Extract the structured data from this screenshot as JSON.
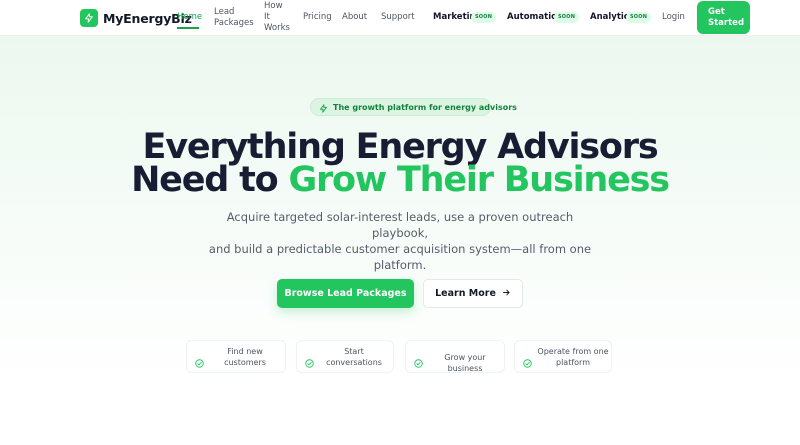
{
  "brand": {
    "name": "MyEnergyBiz",
    "accent": "#22c55e",
    "accent_dark": "#16a34a"
  },
  "nav": {
    "home": "Home",
    "lead_packages": [
      "Lead",
      "Packages"
    ],
    "how_it_works": [
      "How",
      "It",
      "Works"
    ],
    "pricing": "Pricing",
    "about": "About",
    "support": "Support",
    "marketing": "Marketing",
    "automation": "Automation",
    "analytics": "Analytics",
    "soon": "SOON",
    "login": "Login",
    "get_started": [
      "Get",
      "Started"
    ]
  },
  "hero": {
    "pill": "The growth platform for energy advisors",
    "headline_line1": "Everything Energy Advisors",
    "headline_line2_prefix": "Need to ",
    "headline_line2_highlight": "Grow Their Business",
    "subtitle": [
      "Acquire targeted solar-interest leads, use a proven outreach playbook,",
      "and build a predictable customer acquisition system—all from one",
      "platform."
    ],
    "primary_button": "Browse Lead Packages",
    "secondary_button": "Learn More"
  },
  "features": [
    {
      "lines": [
        "Find new",
        "customers"
      ]
    },
    {
      "lines": [
        "Start",
        "conversations"
      ]
    },
    {
      "lines": [
        "Grow your business"
      ]
    },
    {
      "lines": [
        "Operate from one",
        "platform"
      ]
    }
  ],
  "icons": [
    "bolt-icon",
    "check-circle-icon",
    "arrow-right-icon"
  ]
}
